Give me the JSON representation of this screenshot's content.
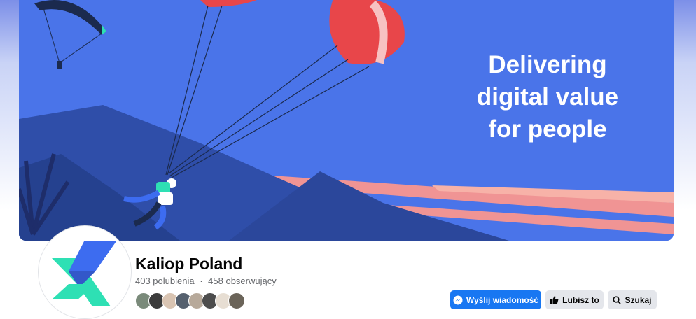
{
  "cover": {
    "slogan_lines": [
      "Delivering",
      "digital value",
      "for people"
    ]
  },
  "page": {
    "name": "Kaliop Poland",
    "likes": "403 polubienia",
    "separator": "·",
    "followers": "458 obserwujący",
    "friend_avatar_count": 8
  },
  "actions": {
    "message_label": "Wyślij wiadomość",
    "like_label": "Lubisz to",
    "search_label": "Szukaj"
  },
  "icons": {
    "message": "messenger-icon",
    "like": "thumbs-up-icon",
    "search": "search-icon"
  },
  "colors": {
    "cover_sky": "#4a74e9",
    "mountains": "#2f4ea9",
    "accent_salmon": "#f09494",
    "paraglider_red": "#e8464a",
    "primary_button": "#1877f2",
    "secondary_button": "#e4e6eb",
    "logo_teal": "#2ee0b4",
    "logo_blue": "#3d6cf0"
  }
}
